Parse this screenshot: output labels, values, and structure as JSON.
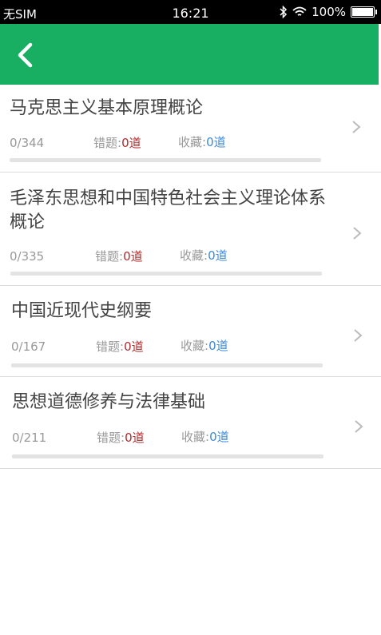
{
  "status_bar": {
    "carrier": "无SIM",
    "time": "16:21",
    "battery_text": "100%",
    "battery_level": 1.0
  },
  "header": {
    "back_icon": "chevron-left-icon",
    "color": "#19af63"
  },
  "subjects": [
    {
      "title": "马克思主义基本原理概论",
      "count": "0/344",
      "wrong_label": "错题:",
      "wrong_value": "0道",
      "fav_label": "收藏:",
      "fav_value": "0道",
      "progress": 0
    },
    {
      "title": "毛泽东思想和中国特色社会主义理论体系概论",
      "count": "0/335",
      "wrong_label": "错题:",
      "wrong_value": "0道",
      "fav_label": "收藏:",
      "fav_value": "0道",
      "progress": 0
    },
    {
      "title": "中国近现代史纲要",
      "count": "0/167",
      "wrong_label": "错题:",
      "wrong_value": "0道",
      "fav_label": "收藏:",
      "fav_value": "0道",
      "progress": 0
    },
    {
      "title": "思想道德修养与法律基础",
      "count": "0/211",
      "wrong_label": "错题:",
      "wrong_value": "0道",
      "fav_label": "收藏:",
      "fav_value": "0道",
      "progress": 0
    }
  ]
}
